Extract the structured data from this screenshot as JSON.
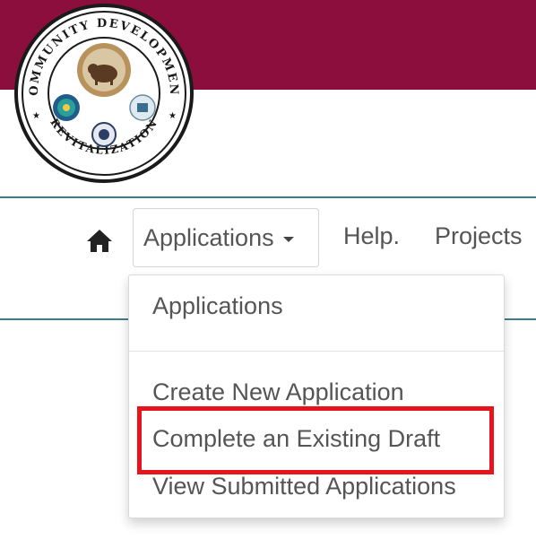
{
  "header": {
    "brand_color": "#8b0e3c",
    "accent_rule_color": "#3f7f86"
  },
  "logo": {
    "top_text": "COMMUNITY DEVELOPMENT",
    "bottom_text": "REVITALIZATION",
    "icon_name": "community-development-seal"
  },
  "nav": {
    "home_icon": "home-icon",
    "applications_label": "Applications",
    "help_label": "Help.",
    "projects_label": "Projects"
  },
  "dropdown": {
    "header_label": "Applications",
    "items": [
      {
        "label": "Create New Application"
      },
      {
        "label": "Complete an Existing Draft"
      },
      {
        "label": "View Submitted Applications"
      }
    ]
  },
  "highlight": {
    "color": "#e8141b",
    "target": "Complete an Existing Draft"
  }
}
